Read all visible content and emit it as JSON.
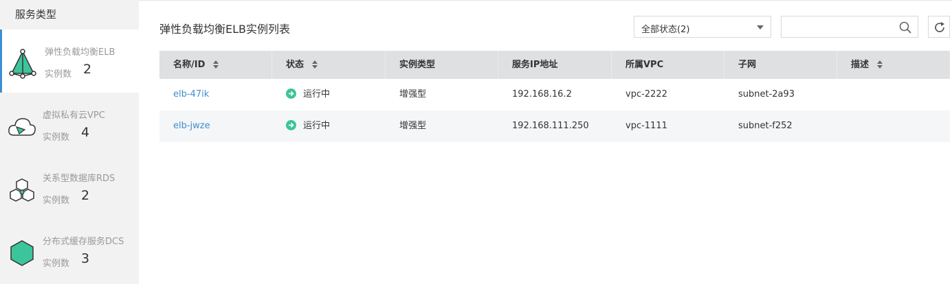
{
  "sidebar": {
    "header": "服务类型",
    "count_label": "实例数",
    "items": [
      {
        "name": "弹性负载均衡ELB",
        "count": "2",
        "icon": "elb-icon"
      },
      {
        "name": "虚拟私有云VPC",
        "count": "4",
        "icon": "vpc-cloud-icon"
      },
      {
        "name": "关系型数据库RDS",
        "count": "2",
        "icon": "rds-icon"
      },
      {
        "name": "分布式缓存服务DCS",
        "count": "3",
        "icon": "dcs-icon"
      }
    ]
  },
  "main": {
    "title": "弹性负载均衡ELB实例列表",
    "status_filter": {
      "selected": "全部状态(2)"
    },
    "search": {
      "placeholder": ""
    }
  },
  "table": {
    "columns": [
      "名称/ID",
      "状态",
      "实例类型",
      "服务IP地址",
      "所属VPC",
      "子网",
      "描述"
    ],
    "rows": [
      {
        "name": "elb-47ik",
        "status": "运行中",
        "type": "增强型",
        "ip": "192.168.16.2",
        "vpc": "vpc-2222",
        "subnet": "subnet-2a93",
        "desc": ""
      },
      {
        "name": "elb-jwze",
        "status": "运行中",
        "type": "增强型",
        "ip": "192.168.111.250",
        "vpc": "vpc-1111",
        "subnet": "subnet-f252",
        "desc": ""
      }
    ]
  },
  "colors": {
    "accent": "#3e8ed0",
    "status_running": "#3cc49b",
    "elb_green": "#3cc49b"
  }
}
